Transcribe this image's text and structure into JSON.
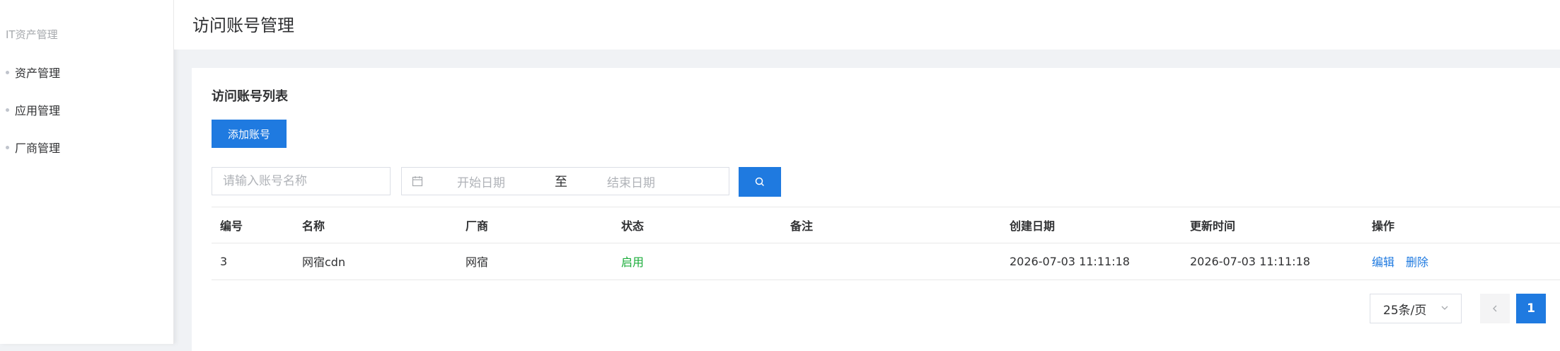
{
  "sidebar": {
    "group_title": "IT资产管理",
    "items": [
      {
        "label": "资产管理"
      },
      {
        "label": "应用管理"
      },
      {
        "label": "厂商管理"
      }
    ]
  },
  "header": {
    "title": "访问账号管理"
  },
  "card": {
    "title": "访问账号列表",
    "add_button": "添加账号",
    "filters": {
      "name_placeholder": "请输入账号名称",
      "start_date": "开始日期",
      "separator": "至",
      "end_date": "结束日期"
    },
    "table": {
      "columns": [
        "编号",
        "名称",
        "厂商",
        "状态",
        "备注",
        "创建日期",
        "更新时间",
        "操作"
      ],
      "rows": [
        {
          "id": "3",
          "name": "网宿cdn",
          "vendor": "网宿",
          "status": "启用",
          "remark": "",
          "created": "2026-07-03 11:11:18",
          "updated": "2026-07-03 11:11:18",
          "actions": [
            "编辑",
            "删除"
          ]
        }
      ]
    },
    "pagination": {
      "page_size": "25条/页",
      "prev": "<",
      "current_page": "1"
    }
  },
  "colors": {
    "primary": "#1f7ae0",
    "success": "#1aad3a"
  }
}
